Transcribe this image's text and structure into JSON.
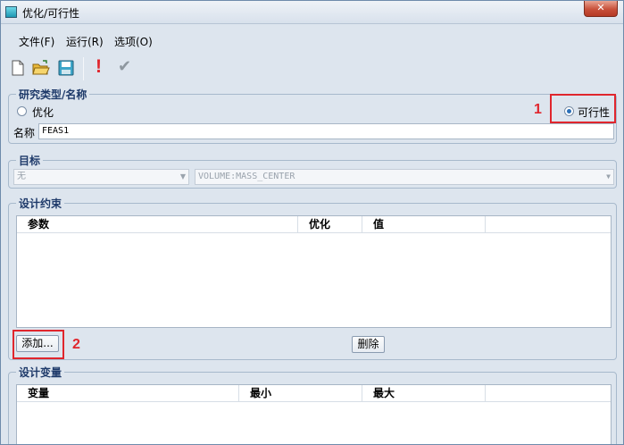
{
  "window": {
    "title": "优化/可行性",
    "close_glyph": "✕"
  },
  "menu": [
    "文件(F)",
    "运行(R)",
    "选项(O)"
  ],
  "toolbar": {
    "icons": [
      "new-file-icon",
      "open-folder-icon",
      "save-icon",
      "run-icon",
      "check-icon"
    ],
    "run_glyph": "!",
    "check_glyph": "✔"
  },
  "study": {
    "group_title": "研究类型/名称",
    "option_optimize": "优化",
    "option_feasibility": "可行性",
    "selected": "可行性",
    "name_label": "名称",
    "name_value": "FEAS1"
  },
  "goal": {
    "group_title": "目标",
    "type_value": "无",
    "measure_value": "VOLUME:MASS_CENTER"
  },
  "constraints": {
    "group_title": "设计约束",
    "columns": [
      "参数",
      "优化",
      "值"
    ],
    "rows": [],
    "add_button": "添加...",
    "delete_button": "删除"
  },
  "variables": {
    "group_title": "设计变量",
    "columns": [
      "变量",
      "最小",
      "最大"
    ],
    "rows": []
  },
  "callouts": {
    "one": "1",
    "two": "2"
  },
  "colors": {
    "accent_red": "#e0262d",
    "radio_blue": "#2a6fb8"
  }
}
